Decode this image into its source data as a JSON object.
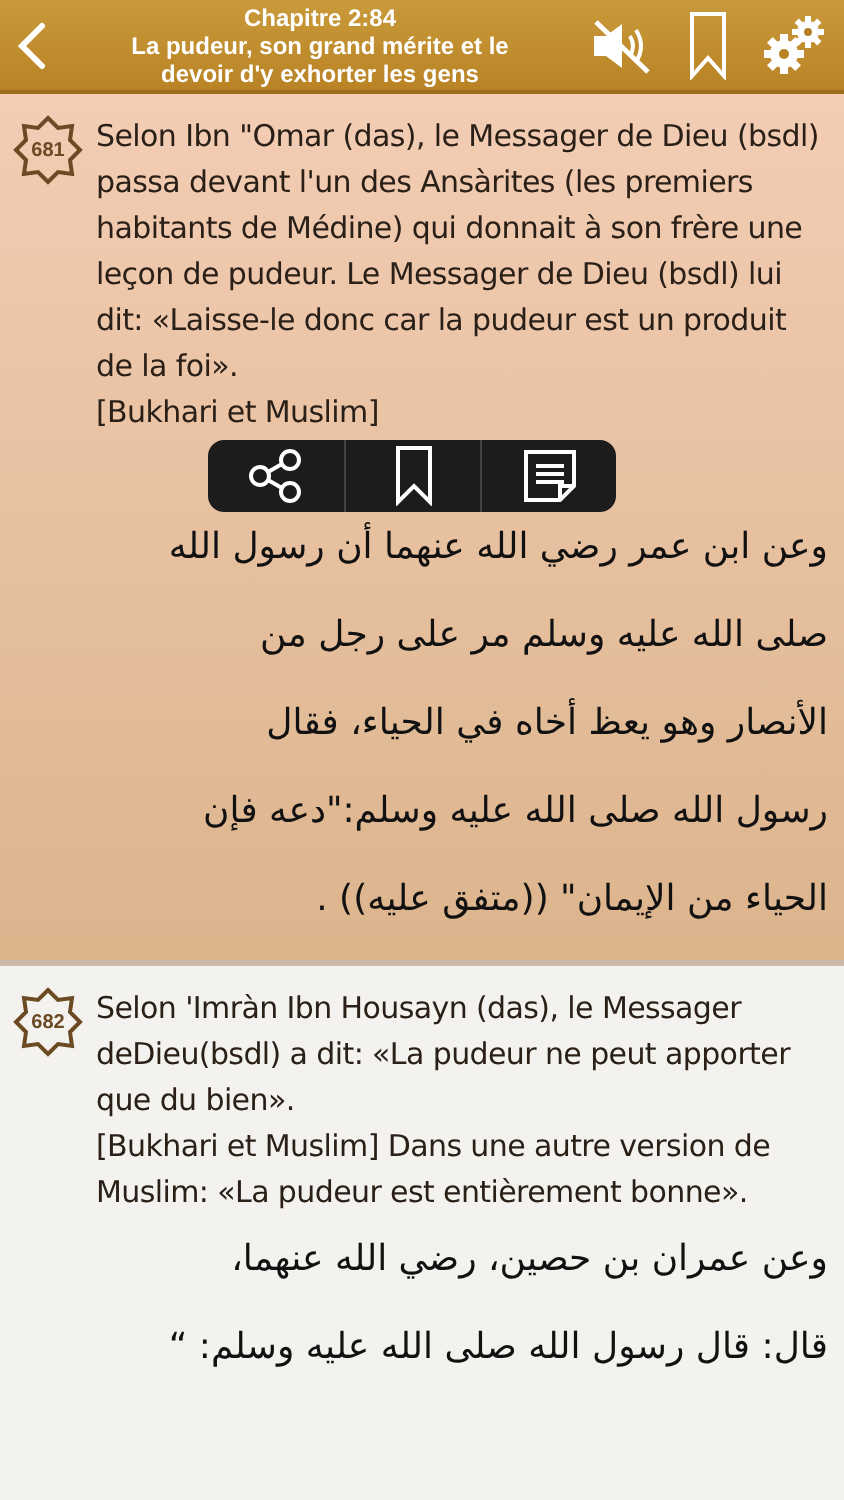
{
  "header": {
    "chapter": "Chapitre 2:84",
    "title": "La pudeur, son grand mérite et le devoir d'y exhorter les gens",
    "sound_muted": true
  },
  "popup_menu": {
    "actions": [
      {
        "kind": "share"
      },
      {
        "kind": "bookmark"
      },
      {
        "kind": "note"
      }
    ]
  },
  "hadiths": [
    {
      "number": "681",
      "selected": true,
      "french": [
        "Selon Ibn \"Omar (das), le Messager de Dieu (bsdl) passa devant l'un des Ansàrites (les premiers habitants de Médine) qui donnait à son frère une leçon de pudeur. Le Messager de Dieu (bsdl) lui dit: «Laisse-le donc car la pudeur est un produit de la foi».",
        "[Bukhari et Muslim]"
      ],
      "arabic_lines": [
        "وعن ابن عمر رضي الله عنهما أن رسول الله",
        "صلى الله عليه وسلم مر على رجل من",
        "الأنصار وهو يعظ أخاه في الحياء، فقال",
        "رسول الله صلى الله عليه وسلم:\"دعه فإن",
        "الحياء من الإيمان\" ((متفق عليه)) ."
      ]
    },
    {
      "number": "682",
      "selected": false,
      "french": [
        "Selon 'Imràn Ibn Housayn (das), le Messager deDieu(bsdl) a dit: «La pudeur ne peut apporter que du bien».",
        "[Bukhari et Muslim] Dans une autre version de Muslim: «La pudeur est entièrement bonne»."
      ],
      "arabic_lines": [
        "وعن عمران بن حصين، رضي الله عنهما،",
        "قال: قال رسول الله صلى الله عليه وسلم: “"
      ]
    }
  ]
}
